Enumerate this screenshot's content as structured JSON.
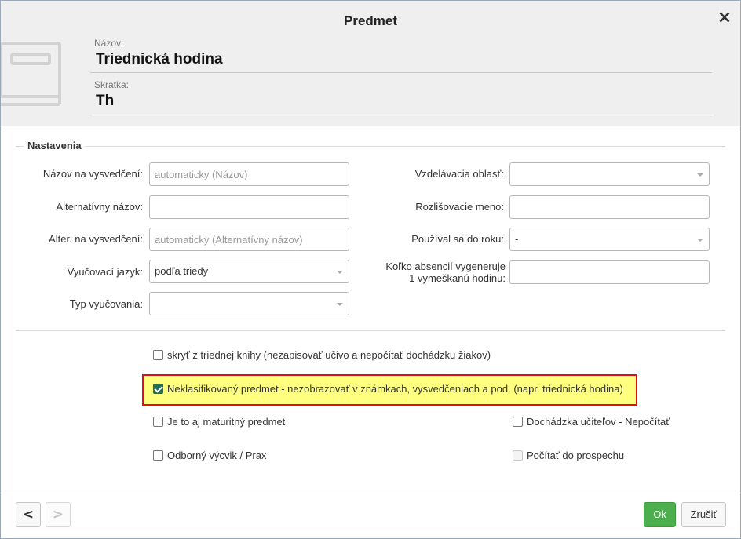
{
  "dialog": {
    "title": "Predmet",
    "close_icon": "×"
  },
  "header": {
    "name_label": "Názov:",
    "name_value": "Triednická hodina",
    "abbr_label": "Skratka:",
    "abbr_value": "Th"
  },
  "settings": {
    "legend": "Nastavenia",
    "left": {
      "certificate_name": {
        "label": "Názov na vysvedčení:",
        "value": "",
        "placeholder": "automaticky (Názov)"
      },
      "alt_name": {
        "label": "Alternatívny názov:",
        "value": ""
      },
      "alt_certificate_name": {
        "label": "Alter. na vysvedčení:",
        "value": "",
        "placeholder": "automaticky (Alternatívny názov)"
      },
      "teaching_language": {
        "label": "Vyučovací jazyk:",
        "value": "podľa triedy"
      },
      "teaching_type": {
        "label": "Typ vyučovania:",
        "value": ""
      }
    },
    "right": {
      "education_area": {
        "label": "Vzdelávacia oblasť:",
        "value": ""
      },
      "distinguishing_name": {
        "label": "Rozlišovacie meno:",
        "value": ""
      },
      "used_until": {
        "label": "Používal sa do roku:",
        "value": "-"
      },
      "absences_per_hour": {
        "label_line1": "Koľko absencií vygeneruje",
        "label_line2": "1 vymeškanú hodinu:",
        "value": ""
      }
    }
  },
  "options": {
    "hide_from_class_book": {
      "label": "skryť z triednej knihy (nezapisovať učivo a nepočítať dochádzku žiakov)",
      "checked": false
    },
    "unclassified": {
      "label": "Neklasifikovaný predmet - nezobrazovať v známkach, vysvedčeniach a pod. (napr. triednická hodina)",
      "checked": true
    },
    "maturita": {
      "label": "Je to aj maturitný predmet",
      "checked": false
    },
    "vocational_training": {
      "label": "Odborný výcvik / Prax",
      "checked": false
    },
    "teacher_attendance": {
      "label": "Dochádzka učiteľov - Nepočítať",
      "checked": false
    },
    "count_in_results": {
      "label": "Počítať do prospechu",
      "checked": false,
      "disabled": true
    }
  },
  "footer": {
    "prev_label": "<",
    "next_label": ">",
    "ok_label": "Ok",
    "cancel_label": "Zrušiť"
  },
  "colors": {
    "highlight_border": "#e01010",
    "highlight_fill": "#ffff80",
    "ok_button": "#4cae4c"
  }
}
